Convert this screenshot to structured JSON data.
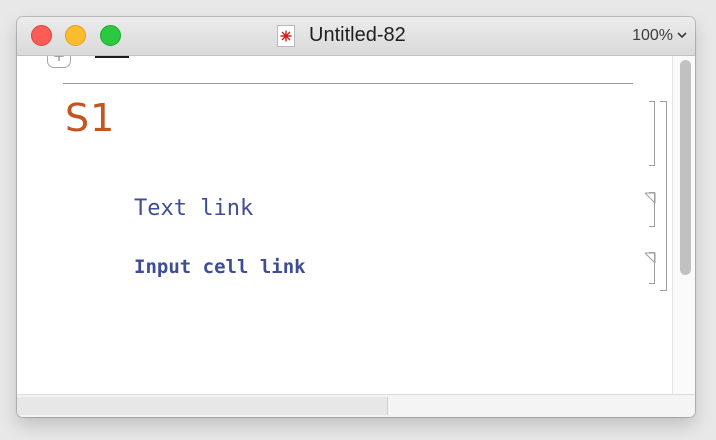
{
  "window": {
    "title": "Untitled-82",
    "zoom": "100%"
  },
  "colors": {
    "section_title": "#c45522",
    "link": "#3f4c96",
    "doc_icon": "#d62020"
  },
  "icons": {
    "document": "mathematica-notebook-icon",
    "zoom_menu": "chevron-down-icon",
    "add_cell": "plus-icon"
  },
  "add_cell_symbol": "+",
  "notebook": {
    "section": "S1",
    "cells": [
      {
        "text": "Text link"
      },
      {
        "text": "Input cell link"
      }
    ]
  }
}
